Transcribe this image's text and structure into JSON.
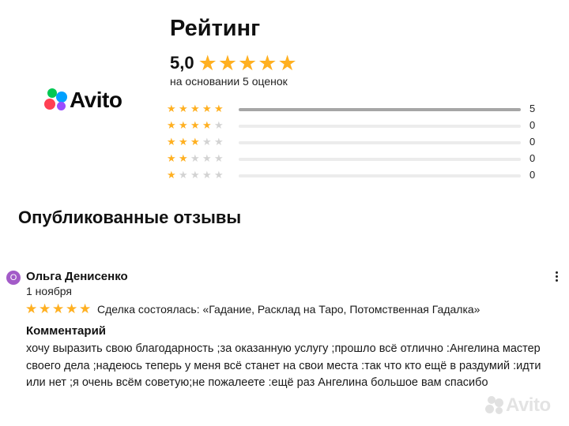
{
  "logo": {
    "text": "Avito"
  },
  "rating": {
    "title": "Рейтинг",
    "score": "5,0",
    "stars": 5,
    "basis": "на основании 5 оценок",
    "distribution": [
      {
        "stars": 5,
        "count": "5",
        "fraction": 1.0
      },
      {
        "stars": 4,
        "count": "0",
        "fraction": 0
      },
      {
        "stars": 3,
        "count": "0",
        "fraction": 0
      },
      {
        "stars": 2,
        "count": "0",
        "fraction": 0
      },
      {
        "stars": 1,
        "count": "0",
        "fraction": 0
      }
    ]
  },
  "reviews_section": {
    "title": "Опубликованные отзывы"
  },
  "review": {
    "avatar_letter": "О",
    "author": "Ольга Денисенко",
    "date": "1 ноября",
    "stars": 5,
    "deal": "Сделка состоялась: «Гадание, Расклад на Таро, Потомственная Гадалка»",
    "comment_label": "Комментарий",
    "comment_lines": [
      "хочу выразить свою благодарность ;за оказанную услугу ;прошло всё отлично :Ангелина мастер",
      "своего дела ;надеюсь теперь у меня всё станет на свои места :так что кто ещё в раздумий :идти",
      "или нет ;я очень всём советую;не пожалеете :ещё раз Ангелина большое вам спасибо"
    ]
  },
  "watermark": {
    "text": "Avito"
  },
  "colors": {
    "star": "#ffb021",
    "star_empty": "#d3d3d3",
    "bar_fill": "#a6a6a6",
    "avatar": "#a35bc8"
  },
  "icons": {
    "menu": "more-vertical-icon",
    "star": "star-icon"
  }
}
